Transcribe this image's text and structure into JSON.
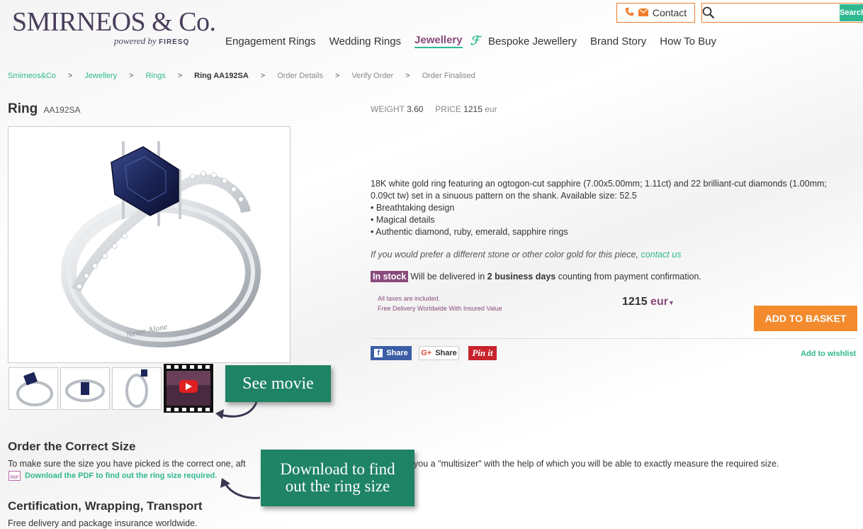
{
  "brand": {
    "name": "SMIRNEOS & Co.",
    "powered_by": "powered by",
    "powered_brand": "FIRESQ"
  },
  "header": {
    "contact_label": "Contact",
    "search_placeholder": "",
    "search_button": "Search"
  },
  "nav": {
    "items": [
      {
        "label": "Engagement Rings"
      },
      {
        "label": "Wedding Rings"
      },
      {
        "label": "Jewellery"
      },
      {
        "label": "Bespoke Jewellery"
      },
      {
        "label": "Brand Story"
      },
      {
        "label": "How To Buy"
      }
    ]
  },
  "breadcrumb": {
    "items": [
      "Smirneos&Co",
      "Jewellery",
      "Rings",
      "Ring AA192SA",
      "Order Details",
      "Verify Order",
      "Order Finalised"
    ],
    "sep": ">"
  },
  "product": {
    "title": "Ring",
    "code": "AA192SA",
    "weight_label": "WEIGHT",
    "weight_value": "3.60",
    "price_label": "PRICE",
    "price_value": "1215",
    "price_unit": "eur",
    "description": "18K white gold ring featuring an ogtogon-cut sapphire (7.00x5.00mm; 1.11ct) and 22 brilliant-cut diamonds (1.00mm; 0.09ct tw) set in a sinuous pattern on the shank. Available size: 52.5",
    "bullets": [
      "• Breathtaking design",
      "• Magical details",
      "• Authentic diamond, ruby, emerald, sapphire rings"
    ],
    "prefer_text": "If you would prefer a different stone or other color gold for this piece, ",
    "prefer_link": "contact us",
    "stock_badge": "In stock",
    "stock_text_1": "Will be delivered in ",
    "stock_text_bold": "2 business days",
    "stock_text_2": " counting from payment confirmation.",
    "taxes_line1": "All taxes are included.",
    "taxes_line2": "Free Delivery Worldwide With Insured Value",
    "big_price": "1215",
    "big_currency": "eur",
    "basket_label": "ADD TO BASKET",
    "wishlist_label": "Add to wishlist"
  },
  "share": {
    "facebook": "Share",
    "google": "Share",
    "pinterest": "Pin it"
  },
  "callouts": {
    "movie": "See movie",
    "pdf_line1": "Download to find",
    "pdf_line2": "out the ring size"
  },
  "size_section": {
    "title": "Order the Correct Size",
    "text_left": "To make sure the size you have picked is the correct one, aft",
    "text_right": "you a \"multisizer\" with the help of which you will be able to exactly measure the required size.",
    "pdf_link": "Download the PDF to find out the ring size required."
  },
  "cert_section": {
    "title": "Certification, Wrapping, Transport",
    "text": "Free delivery and package insurance worldwide."
  }
}
